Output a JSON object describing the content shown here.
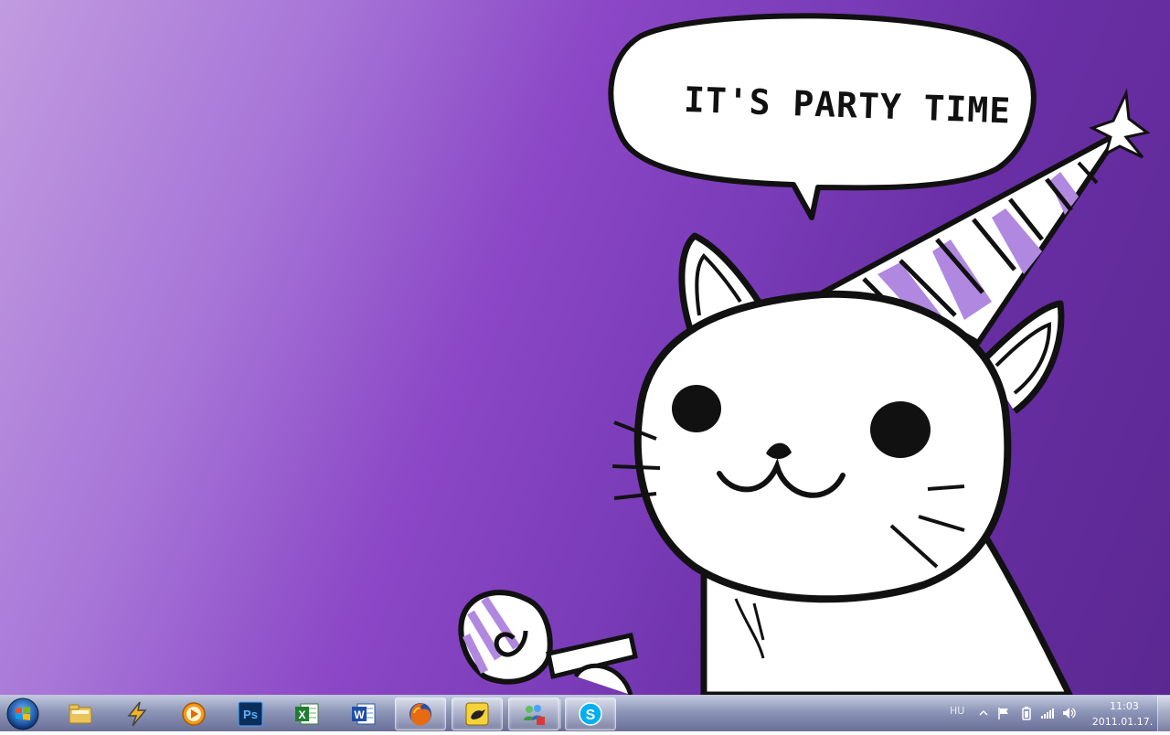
{
  "wallpaper": {
    "speech_bubble_text": "IT'S PARTY TIME",
    "colors": {
      "background_light": "#c19be0",
      "background_dark": "#5b2891",
      "outline": "#111111",
      "stripe": "#b188e0"
    }
  },
  "taskbar": {
    "start_button_icon": "windows-logo-icon",
    "pinned": [
      {
        "name": "windows-explorer",
        "icon": "folder-icon"
      },
      {
        "name": "winamp",
        "icon": "lightning-icon"
      },
      {
        "name": "media-player",
        "icon": "play-circle-icon"
      },
      {
        "name": "photoshop",
        "icon": "ps-icon",
        "label": "Ps"
      },
      {
        "name": "excel",
        "icon": "excel-icon",
        "label": "X"
      },
      {
        "name": "word",
        "icon": "word-icon",
        "label": "W"
      },
      {
        "name": "firefox",
        "icon": "firefox-icon"
      },
      {
        "name": "bird-app",
        "icon": "bird-icon"
      },
      {
        "name": "messenger",
        "icon": "people-icon"
      },
      {
        "name": "skype",
        "icon": "skype-icon",
        "label": "S"
      }
    ]
  },
  "tray": {
    "language": "HU",
    "time": "11:03",
    "date": "2011.01.17."
  }
}
